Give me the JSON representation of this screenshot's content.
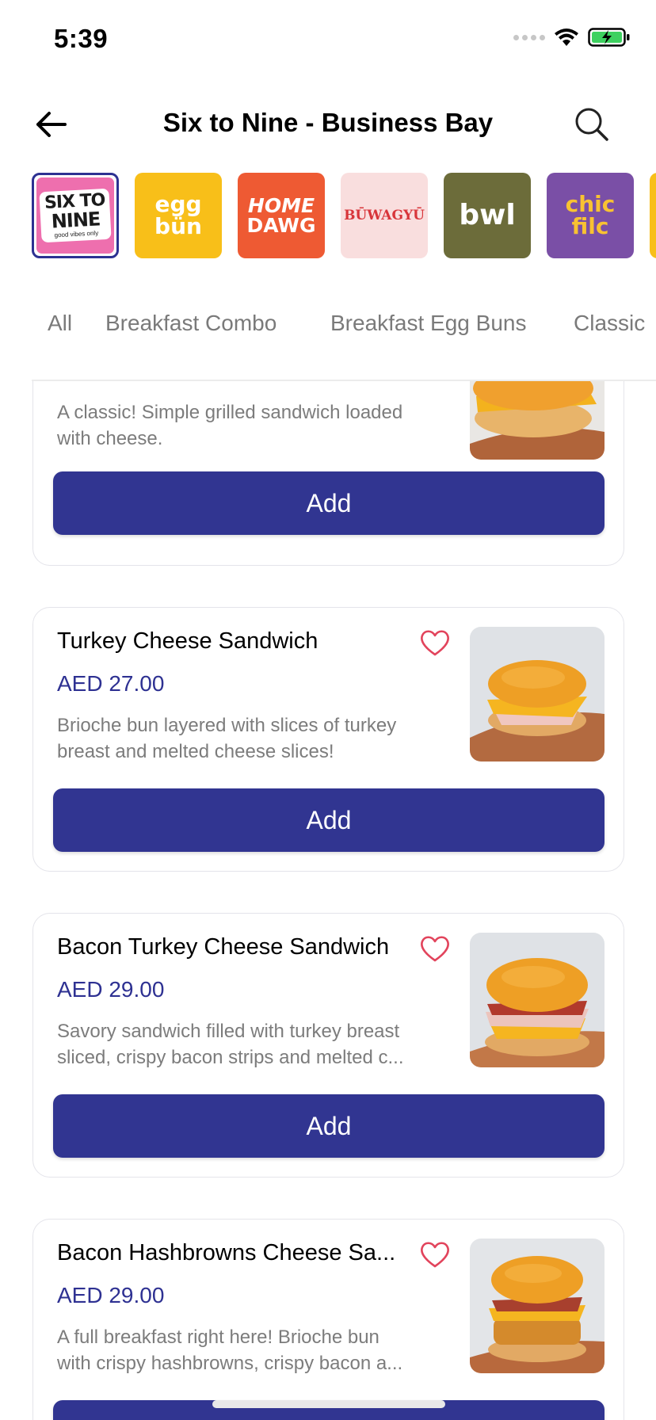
{
  "status_bar": {
    "time": "5:39"
  },
  "header": {
    "title": "Six to Nine - Business Bay"
  },
  "brands": [
    {
      "name": "Six to Nine",
      "line1": "SIX TO",
      "line2": "NINE",
      "line3": "good vibes only",
      "bg": "#ee6fae",
      "fg": "#1b1b1b",
      "selected": true
    },
    {
      "name": "Egg Bun",
      "line1": "egg",
      "line2": "bün",
      "bg": "#f8bf19",
      "fg": "#ffffff"
    },
    {
      "name": "Home Dawg",
      "line1": "HOME",
      "line2": "DAWG",
      "bg": "#ee5a33",
      "fg": "#ffffff"
    },
    {
      "name": "Buwagyu",
      "line1": "BŪWAGYŪ",
      "bg": "#f9dede",
      "fg": "#d8353a"
    },
    {
      "name": "bwl",
      "line1": "bwl",
      "bg": "#6c6c3a",
      "fg": "#ffffff"
    },
    {
      "name": "Chic Filc",
      "line1": "chic",
      "line2": "filc",
      "bg": "#7a4fa6",
      "fg": "#f8c232"
    }
  ],
  "categories": [
    "All",
    "Breakfast Combo",
    "Breakfast Egg Buns",
    "Classic"
  ],
  "products": [
    {
      "name": "",
      "price": "",
      "desc_line1": "A classic! Simple grilled sandwich loaded",
      "desc_line2": "with cheese.",
      "add_label": "Add"
    },
    {
      "name": "Turkey Cheese Sandwich",
      "price": "AED 27.00",
      "desc_line1": "Brioche bun layered with slices of turkey",
      "desc_line2": "breast and melted cheese slices!",
      "add_label": "Add"
    },
    {
      "name": "Bacon Turkey Cheese Sandwich",
      "price": "AED 29.00",
      "desc_line1": "Savory sandwich filled with turkey breast",
      "desc_line2": "sliced, crispy bacon strips and melted c...",
      "add_label": "Add"
    },
    {
      "name": "Bacon Hashbrowns Cheese Sa...",
      "price": "AED 29.00",
      "desc_line1": "A full breakfast right here! Brioche bun",
      "desc_line2": "with crispy hashbrowns, crispy bacon a...",
      "add_label": "Add"
    }
  ],
  "colors": {
    "accent": "#313591",
    "price": "#2e3192",
    "heart": "#e2445c"
  }
}
